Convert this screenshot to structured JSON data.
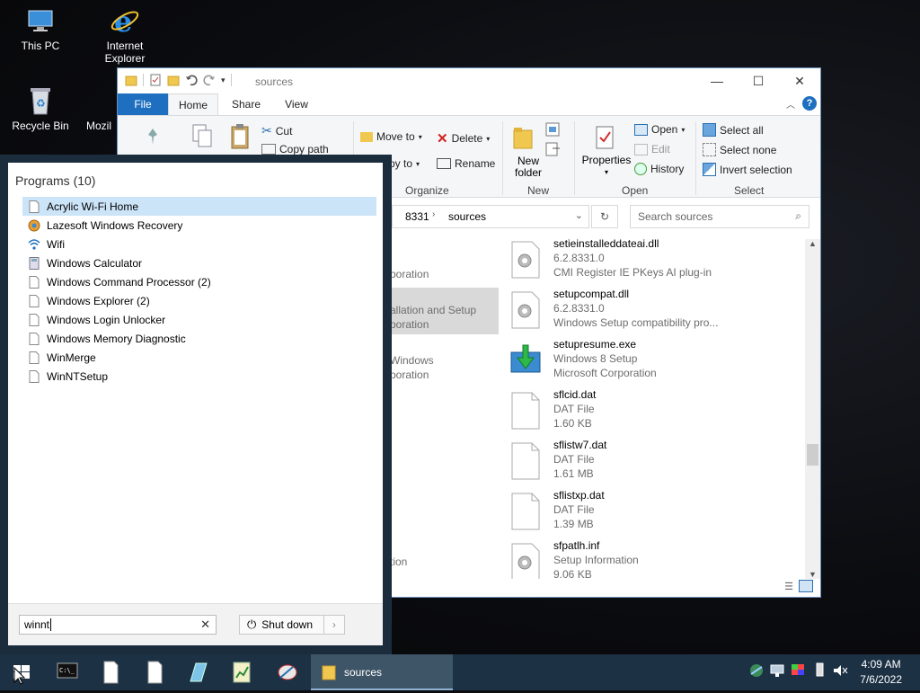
{
  "desktop": {
    "icons": [
      {
        "label": "This PC"
      },
      {
        "label": "Internet Explorer"
      },
      {
        "label": "Recycle Bin"
      },
      {
        "label": "Mozil"
      }
    ]
  },
  "explorer": {
    "title": "sources",
    "tabs": [
      "File",
      "Home",
      "Share",
      "View"
    ],
    "ribbon": {
      "cut": "Cut",
      "copy_path": "Copy path",
      "move_to": "Move to",
      "copy_to": "py to",
      "delete": "Delete",
      "rename": "Rename",
      "organize": "Organize",
      "new_folder_1": "New",
      "new_folder_2": "folder",
      "new_group": "New",
      "properties": "Properties",
      "open": "Open",
      "edit": "Edit",
      "history": "History",
      "open_group": "Open",
      "select_all": "Select all",
      "select_none": "Select none",
      "invert_selection": "Invert selection",
      "select_group": "Select"
    },
    "address": {
      "crumb1": "8331",
      "crumb2": "sources"
    },
    "search_placeholder": "Search sources",
    "left_fragments": [
      "poration",
      "allation and Setup",
      "poration",
      "Windows",
      "poration",
      "tion"
    ],
    "files": [
      {
        "name": "setieinstalleddateai.dll",
        "line2": "6.2.8331.0",
        "line3": "CMI Register IE PKeys AI plug-in",
        "icon": "gear-file-icon"
      },
      {
        "name": "setupcompat.dll",
        "line2": "6.2.8331.0",
        "line3": "Windows Setup compatibility pro...",
        "icon": "gear-file-icon"
      },
      {
        "name": "setupresume.exe",
        "line2": "Windows 8 Setup",
        "line3": "Microsoft Corporation",
        "icon": "setup-arrow-icon"
      },
      {
        "name": "sflcid.dat",
        "line2": "DAT File",
        "line3": "1.60 KB",
        "icon": "blank-file-icon"
      },
      {
        "name": "sflistw7.dat",
        "line2": "DAT File",
        "line3": "1.61 MB",
        "icon": "blank-file-icon"
      },
      {
        "name": "sflistxp.dat",
        "line2": "DAT File",
        "line3": "1.39 MB",
        "icon": "blank-file-icon"
      },
      {
        "name": "sfpatlh.inf",
        "line2": "Setup Information",
        "line3": "9.06 KB",
        "icon": "gear-file-icon"
      }
    ]
  },
  "startmenu": {
    "heading": "Programs (10)",
    "programs": [
      {
        "label": "Acrylic Wi-Fi Home",
        "icon": "blank-file-icon",
        "selected": true
      },
      {
        "label": "Lazesoft Windows Recovery",
        "icon": "lazesoft-icon"
      },
      {
        "label": "Wifi",
        "icon": "wifi-icon"
      },
      {
        "label": "Windows Calculator",
        "icon": "calculator-icon"
      },
      {
        "label": "Windows Command Processor (2)",
        "icon": "blank-file-icon"
      },
      {
        "label": "Windows Explorer (2)",
        "icon": "blank-file-icon"
      },
      {
        "label": "Windows Login Unlocker",
        "icon": "blank-file-icon"
      },
      {
        "label": "Windows Memory Diagnostic",
        "icon": "blank-file-icon"
      },
      {
        "label": "WinMerge",
        "icon": "blank-file-icon"
      },
      {
        "label": "WinNTSetup",
        "icon": "blank-file-icon"
      }
    ],
    "search_value": "winnt",
    "shutdown_label": "Shut down"
  },
  "taskbar": {
    "active_label": "sources",
    "clock_time": "4:09 AM",
    "clock_date": "7/6/2022"
  }
}
